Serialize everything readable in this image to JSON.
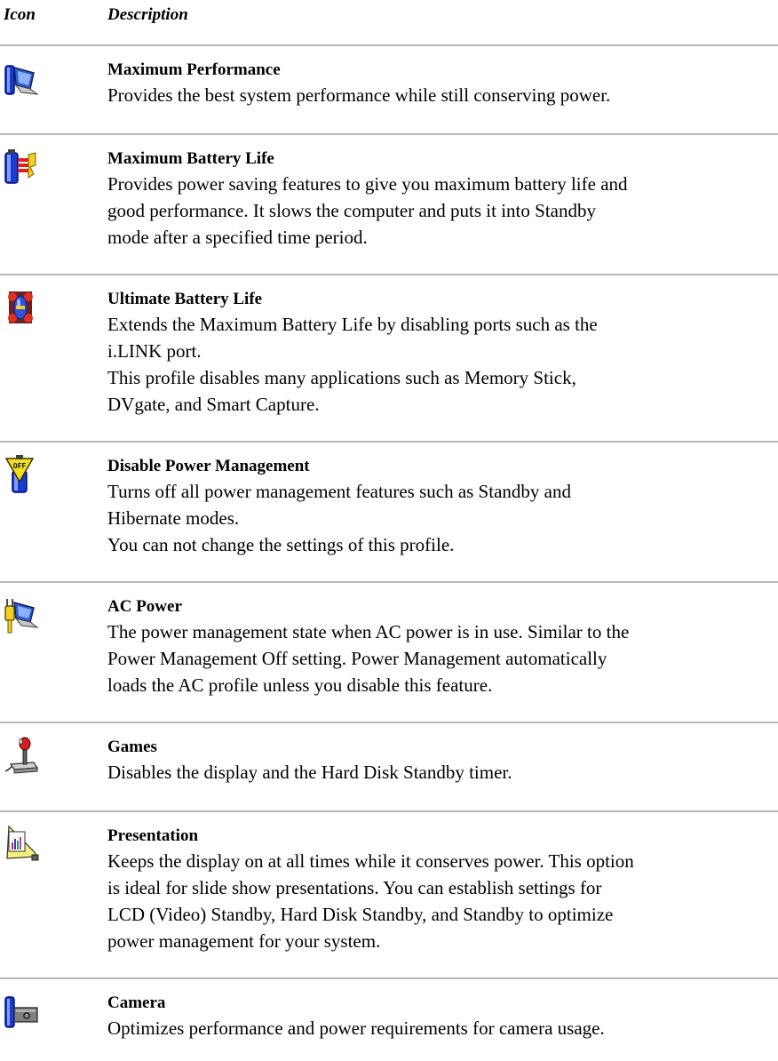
{
  "header": {
    "icon_label": "Icon",
    "description_label": "Description"
  },
  "profiles": [
    {
      "icon": "maximum-performance-icon",
      "title": "Maximum Performance",
      "lines": [
        "Provides the best system performance while still conserving power."
      ]
    },
    {
      "icon": "maximum-battery-life-icon",
      "title": "Maximum Battery Life",
      "lines": [
        "Provides power saving features to give you maximum battery life and",
        "good performance. It slows the computer and puts it into Standby",
        "mode after a specified time period."
      ]
    },
    {
      "icon": "ultimate-battery-life-icon",
      "title": "Ultimate Battery Life",
      "lines": [
        "Extends the Maximum Battery Life by disabling ports such as the",
        "i.LINK port.",
        "This profile disables many applications such as Memory Stick,",
        "DVgate, and Smart Capture."
      ]
    },
    {
      "icon": "disable-power-management-icon",
      "title": "Disable Power Management",
      "icon_text": "OFF",
      "lines": [
        "Turns off all power management features such as Standby and",
        "Hibernate modes.",
        "You can not change the settings of this profile."
      ]
    },
    {
      "icon": "ac-power-icon",
      "title": "AC Power",
      "lines": [
        "The power management state when AC power is in use. Similar to the",
        "Power Management Off setting. Power Management automatically",
        "loads the AC profile unless you disable this feature."
      ]
    },
    {
      "icon": "games-joystick-icon",
      "title": "Games",
      "lines": [
        "Disables the display and the Hard Disk Standby timer."
      ]
    },
    {
      "icon": "presentation-icon",
      "title": "Presentation",
      "lines": [
        "Keeps the display on at all times while it conserves power. This option",
        "is ideal for slide show presentations. You can establish settings for",
        "LCD (Video) Standby, Hard Disk Standby, and Standby to optimize",
        "power management for your system."
      ]
    },
    {
      "icon": "camera-icon",
      "title": "Camera",
      "lines": [
        "Optimizes performance and power requirements for camera usage."
      ]
    }
  ]
}
